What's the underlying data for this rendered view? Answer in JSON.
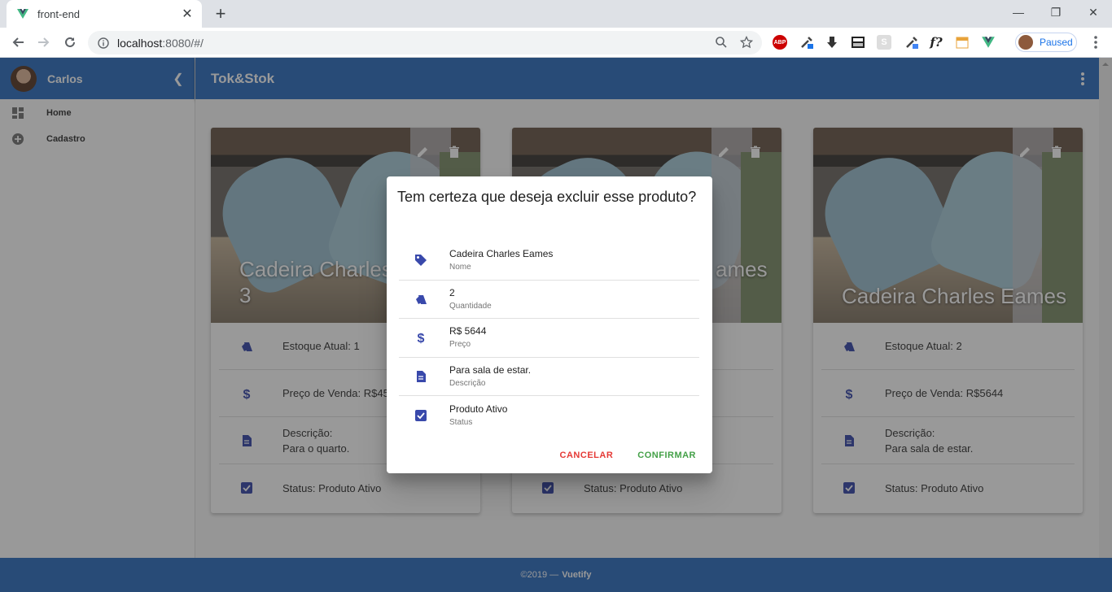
{
  "browser": {
    "tab_title": "front-end",
    "url_host": "localhost",
    "url_rest": ":8080/#/",
    "profile_label": "Paused",
    "ext_abp": "ABP",
    "ext_fx": "f?"
  },
  "drawer": {
    "user_name": "Carlos",
    "items": [
      {
        "label": "Home",
        "icon": "dashboard-icon"
      },
      {
        "label": "Cadastro",
        "icon": "add-circle-icon"
      }
    ]
  },
  "appbar": {
    "title": "Tok&Stok"
  },
  "cards": [
    {
      "title": "Cadeira Charles\n3",
      "stock": "Estoque Atual: 1",
      "price": "Preço de Venda: R$45",
      "desc_label": "Descrição:",
      "desc": "Para o quarto.",
      "status": "Status: Produto Ativo"
    },
    {
      "title": "ames",
      "stock": "",
      "price": "",
      "desc_label": "",
      "desc": "",
      "status": "Status: Produto Ativo"
    },
    {
      "title": "Cadeira Charles Eames",
      "stock": "Estoque Atual: 2",
      "price": "Preço de Venda: R$5644",
      "desc_label": "Descrição:",
      "desc": "Para sala de estar.",
      "status": "Status: Produto Ativo"
    }
  ],
  "footer": {
    "copyright": "©2019 —",
    "brand": "Vuetify"
  },
  "dialog": {
    "title": "Tem certeza que deseja excluir esse produto?",
    "rows": [
      {
        "value": "Cadeira Charles Eames",
        "label": "Nome",
        "icon": "tag-icon"
      },
      {
        "value": "2",
        "label": "Quantidade",
        "icon": "tags-icon"
      },
      {
        "value": "R$ 5644",
        "label": "Preço",
        "icon": "dollar-icon"
      },
      {
        "value": "Para sala de estar.",
        "label": "Descrição",
        "icon": "description-icon"
      },
      {
        "value": "Produto Ativo",
        "label": "Status",
        "icon": "checkbox-icon"
      }
    ],
    "cancel_label": "CANCELAR",
    "confirm_label": "CONFIRMAR"
  },
  "colors": {
    "primary": "#2f6fc0",
    "icon": "#3949ab",
    "cancel": "#e53935",
    "confirm": "#43a047"
  }
}
